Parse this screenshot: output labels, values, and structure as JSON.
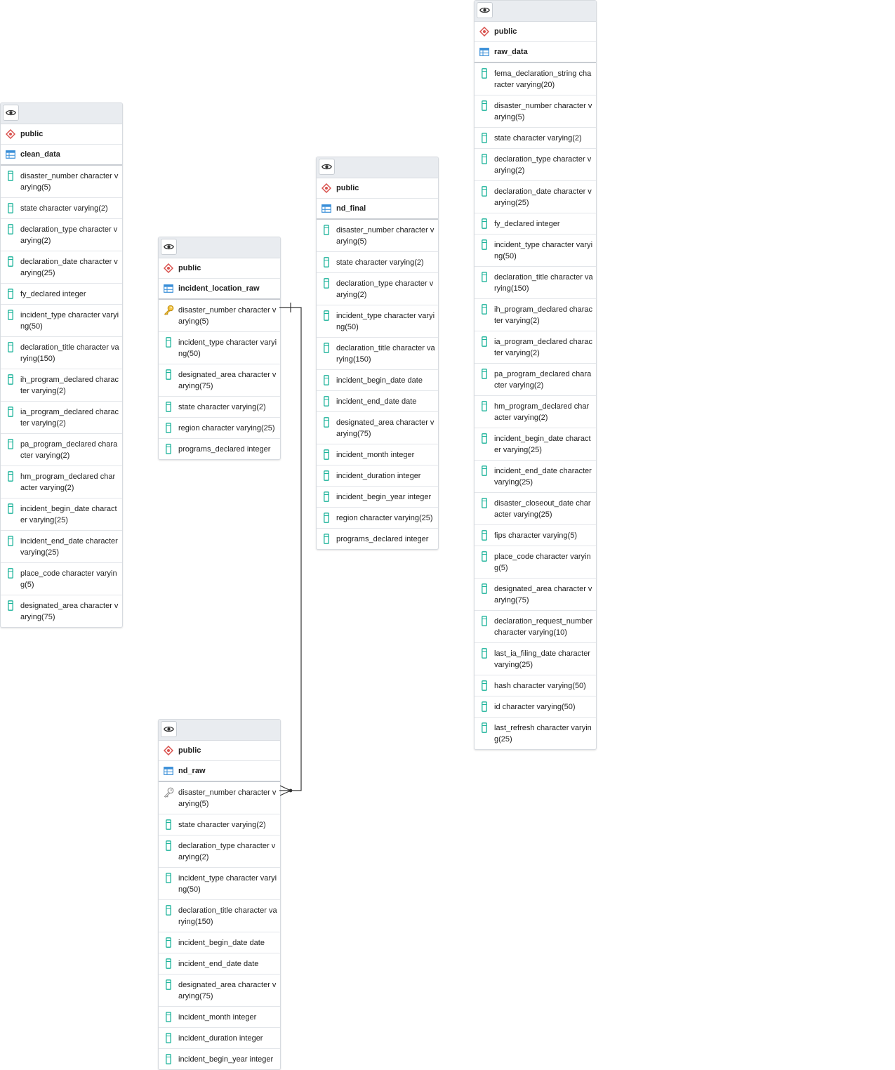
{
  "icons": {
    "view": "eye-icon",
    "schema": "schema-diamond-icon",
    "table": "table-grid-icon",
    "column": "column-icon",
    "primary_key": "primary-key-icon",
    "foreign_key": "foreign-key-icon"
  },
  "colors": {
    "schema_icon": "#d9534f",
    "table_icon": "#3a8fd8",
    "column_icon": "#1bb39a",
    "primary_key_icon": "#e2b11b",
    "foreign_key_icon": "#888888",
    "header_bg": "#e9ecf0",
    "relation_line": "#333333"
  },
  "tables": [
    {
      "id": "clean_data",
      "schema": "public",
      "name": "clean_data",
      "columns": [
        {
          "text": "disaster_number character varying(5)",
          "key": "none"
        },
        {
          "text": "state character varying(2)",
          "key": "none"
        },
        {
          "text": "declaration_type character varying(2)",
          "key": "none"
        },
        {
          "text": "declaration_date character varying(25)",
          "key": "none"
        },
        {
          "text": "fy_declared integer",
          "key": "none"
        },
        {
          "text": "incident_type character varying(50)",
          "key": "none"
        },
        {
          "text": "declaration_title character varying(150)",
          "key": "none"
        },
        {
          "text": "ih_program_declared character varying(2)",
          "key": "none"
        },
        {
          "text": "ia_program_declared character varying(2)",
          "key": "none"
        },
        {
          "text": "pa_program_declared character varying(2)",
          "key": "none"
        },
        {
          "text": "hm_program_declared character varying(2)",
          "key": "none"
        },
        {
          "text": "incident_begin_date character varying(25)",
          "key": "none"
        },
        {
          "text": "incident_end_date character varying(25)",
          "key": "none"
        },
        {
          "text": "place_code character varying(5)",
          "key": "none"
        },
        {
          "text": "designated_area character varying(75)",
          "key": "none"
        }
      ]
    },
    {
      "id": "incident_location_raw",
      "schema": "public",
      "name": "incident_location_raw",
      "columns": [
        {
          "text": "disaster_number character varying(5)",
          "key": "pk"
        },
        {
          "text": "incident_type character varying(50)",
          "key": "none"
        },
        {
          "text": "designated_area character varying(75)",
          "key": "none"
        },
        {
          "text": "state character varying(2)",
          "key": "none"
        },
        {
          "text": "region character varying(25)",
          "key": "none"
        },
        {
          "text": "programs_declared integer",
          "key": "none"
        }
      ]
    },
    {
      "id": "nd_final",
      "schema": "public",
      "name": "nd_final",
      "columns": [
        {
          "text": "disaster_number character varying(5)",
          "key": "none"
        },
        {
          "text": "state character varying(2)",
          "key": "none"
        },
        {
          "text": "declaration_type character varying(2)",
          "key": "none"
        },
        {
          "text": "incident_type character varying(50)",
          "key": "none"
        },
        {
          "text": "declaration_title character varying(150)",
          "key": "none"
        },
        {
          "text": "incident_begin_date date",
          "key": "none"
        },
        {
          "text": "incident_end_date date",
          "key": "none"
        },
        {
          "text": "designated_area character varying(75)",
          "key": "none"
        },
        {
          "text": "incident_month integer",
          "key": "none"
        },
        {
          "text": "incident_duration integer",
          "key": "none"
        },
        {
          "text": "incident_begin_year integer",
          "key": "none"
        },
        {
          "text": "region character varying(25)",
          "key": "none"
        },
        {
          "text": "programs_declared integer",
          "key": "none"
        }
      ]
    },
    {
      "id": "raw_data",
      "schema": "public",
      "name": "raw_data",
      "columns": [
        {
          "text": "fema_declaration_string character varying(20)",
          "key": "none"
        },
        {
          "text": "disaster_number character varying(5)",
          "key": "none"
        },
        {
          "text": "state character varying(2)",
          "key": "none"
        },
        {
          "text": "declaration_type character varying(2)",
          "key": "none"
        },
        {
          "text": "declaration_date character varying(25)",
          "key": "none"
        },
        {
          "text": "fy_declared integer",
          "key": "none"
        },
        {
          "text": "incident_type character varying(50)",
          "key": "none"
        },
        {
          "text": "declaration_title character varying(150)",
          "key": "none"
        },
        {
          "text": "ih_program_declared character varying(2)",
          "key": "none"
        },
        {
          "text": "ia_program_declared character varying(2)",
          "key": "none"
        },
        {
          "text": "pa_program_declared character varying(2)",
          "key": "none"
        },
        {
          "text": "hm_program_declared character varying(2)",
          "key": "none"
        },
        {
          "text": "incident_begin_date character varying(25)",
          "key": "none"
        },
        {
          "text": "incident_end_date character varying(25)",
          "key": "none"
        },
        {
          "text": "disaster_closeout_date character varying(25)",
          "key": "none"
        },
        {
          "text": "fips character varying(5)",
          "key": "none"
        },
        {
          "text": "place_code character varying(5)",
          "key": "none"
        },
        {
          "text": "designated_area character varying(75)",
          "key": "none"
        },
        {
          "text": "declaration_request_number character varying(10)",
          "key": "none"
        },
        {
          "text": "last_ia_filing_date character varying(25)",
          "key": "none"
        },
        {
          "text": "hash character varying(50)",
          "key": "none"
        },
        {
          "text": "id character varying(50)",
          "key": "none"
        },
        {
          "text": "last_refresh character varying(25)",
          "key": "none"
        }
      ]
    },
    {
      "id": "nd_raw",
      "schema": "public",
      "name": "nd_raw",
      "columns": [
        {
          "text": "disaster_number character varying(5)",
          "key": "fk"
        },
        {
          "text": "state character varying(2)",
          "key": "none"
        },
        {
          "text": "declaration_type character varying(2)",
          "key": "none"
        },
        {
          "text": "incident_type character varying(50)",
          "key": "none"
        },
        {
          "text": "declaration_title character varying(150)",
          "key": "none"
        },
        {
          "text": "incident_begin_date date",
          "key": "none"
        },
        {
          "text": "incident_end_date date",
          "key": "none"
        },
        {
          "text": "designated_area character varying(75)",
          "key": "none"
        },
        {
          "text": "incident_month integer",
          "key": "none"
        },
        {
          "text": "incident_duration integer",
          "key": "none"
        },
        {
          "text": "incident_begin_year integer",
          "key": "none"
        }
      ]
    }
  ],
  "relationships": [
    {
      "from_table": "incident_location_raw",
      "from_column": "disaster_number",
      "from_cardinality": "one",
      "to_table": "nd_raw",
      "to_column": "disaster_number",
      "to_cardinality": "many"
    }
  ]
}
